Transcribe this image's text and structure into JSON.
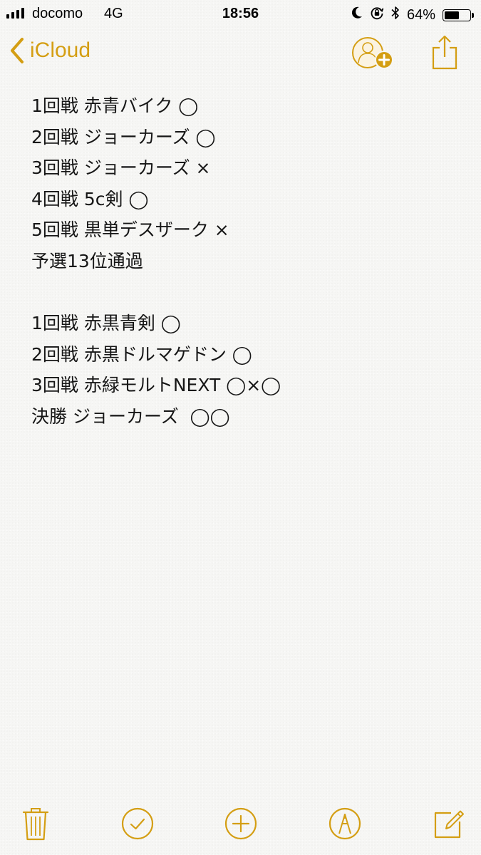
{
  "status_bar": {
    "carrier": "docomo",
    "network": "4G",
    "time": "18:56",
    "battery_percent": "64%",
    "battery_level": 0.64
  },
  "nav": {
    "back_label": "iCloud"
  },
  "note": {
    "lines": [
      "1回戦 赤青バイク ◯",
      "2回戦 ジョーカーズ ◯",
      "3回戦 ジョーカーズ ×",
      "4回戦 5c剣 ◯",
      "5回戦 黒単デスザーク ×",
      "予選13位通過",
      "",
      "1回戦 赤黒青剣 ◯",
      "2回戦 赤黒ドルマゲドン ◯",
      "3回戦 赤緑モルトNEXT ◯×◯",
      "決勝 ジョーカーズ  ◯◯"
    ]
  },
  "icons": {
    "accent_color": "#d49e13",
    "toolbar": [
      "trash-icon",
      "checklist-icon",
      "add-icon",
      "sketch-icon",
      "compose-icon"
    ],
    "nav": [
      "chevron-left-icon",
      "add-people-icon",
      "share-icon"
    ],
    "status": [
      "moon-icon",
      "rotation-lock-icon",
      "bluetooth-icon",
      "battery-icon"
    ]
  }
}
